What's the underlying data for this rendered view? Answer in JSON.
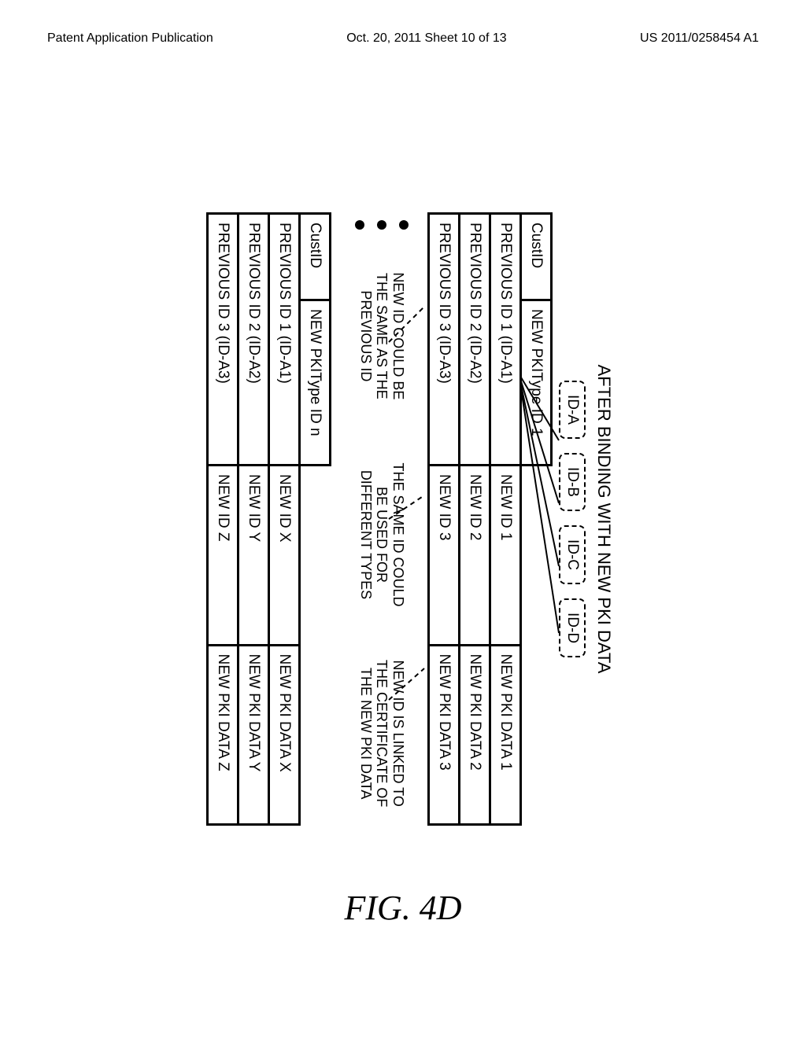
{
  "page_header": {
    "left": "Patent Application Publication",
    "center": "Oct. 20, 2011  Sheet 10 of 13",
    "right": "US 2011/0258454 A1"
  },
  "diagram": {
    "title": "AFTER BINDING WITH NEW PKI DATA",
    "tabs": [
      "ID-A",
      "ID-B",
      "ID-C",
      "ID-D"
    ],
    "table1": {
      "header": {
        "c1": "CustID",
        "c2": "NEW PKIType ID 1"
      },
      "rows": [
        {
          "prev": "PREVIOUS ID 1 (ID-A1)",
          "newid": "NEW ID 1",
          "data": "NEW PKI DATA 1"
        },
        {
          "prev": "PREVIOUS ID 2 (ID-A2)",
          "newid": "NEW ID 2",
          "data": "NEW PKI DATA 2"
        },
        {
          "prev": "PREVIOUS ID 3 (ID-A3)",
          "newid": "NEW ID 3",
          "data": "NEW PKI DATA 3"
        }
      ]
    },
    "notes": {
      "n1": "NEW ID COULD BE\nTHE SAME AS THE\nPREVIOUS ID",
      "n2": "THE SAME ID COULD\nBE USED FOR\nDIFFERENT TYPES",
      "n3": "NEW ID IS LINKED TO\nTHE CERTIFICATE OF\nTHE NEW PKI DATA"
    },
    "table2": {
      "header": {
        "c1": "CustID",
        "c2": "NEW PKIType ID n"
      },
      "rows": [
        {
          "prev": "PREVIOUS ID 1 (ID-A1)",
          "newid": "NEW ID X",
          "data": "NEW PKI DATA X"
        },
        {
          "prev": "PREVIOUS ID 2 (ID-A2)",
          "newid": "NEW ID Y",
          "data": "NEW PKI DATA Y"
        },
        {
          "prev": "PREVIOUS ID 3 (ID-A3)",
          "newid": "NEW ID Z",
          "data": "NEW PKI DATA Z"
        }
      ]
    }
  },
  "figure_label": "FIG. 4D"
}
